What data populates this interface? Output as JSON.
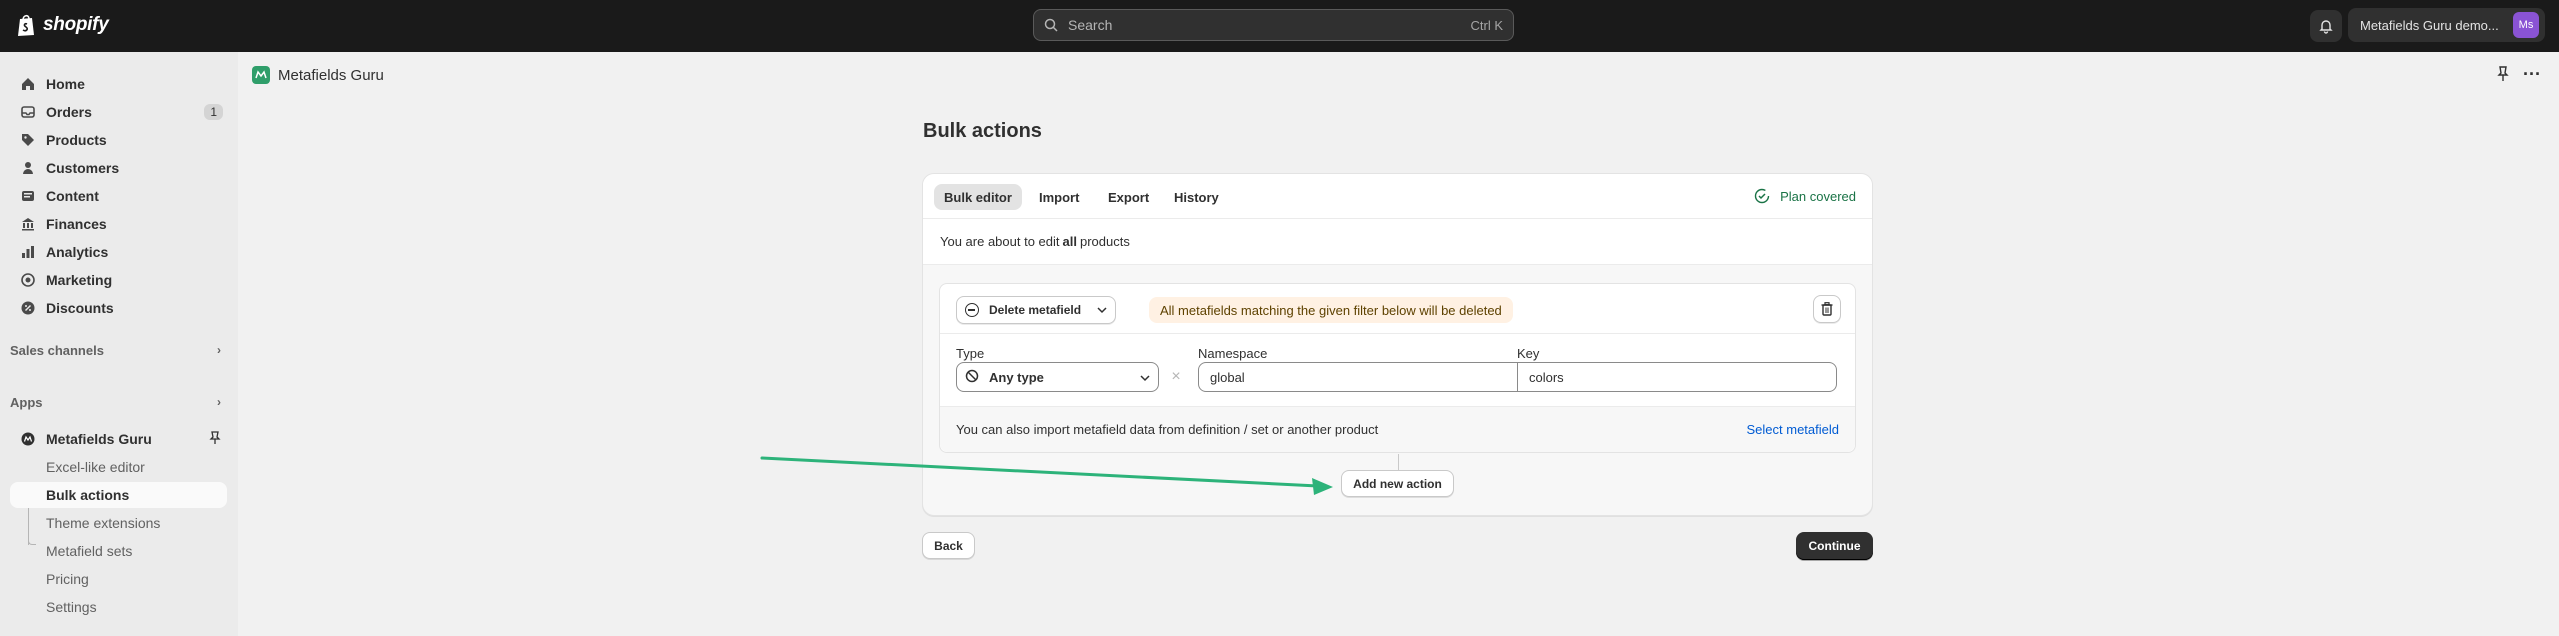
{
  "topbar": {
    "logo_text": "shopify",
    "search_placeholder": "Search",
    "search_shortcut": "Ctrl K",
    "store_name": "Metafields Guru demo...",
    "avatar_initials": "Ms",
    "avatar_color": "#8a53d4"
  },
  "sidebar": {
    "nav": [
      {
        "label": "Home",
        "icon": "home-icon"
      },
      {
        "label": "Orders",
        "icon": "inbox-icon",
        "badge": "1"
      },
      {
        "label": "Products",
        "icon": "tag-icon"
      },
      {
        "label": "Customers",
        "icon": "person-icon"
      },
      {
        "label": "Content",
        "icon": "content-icon"
      },
      {
        "label": "Finances",
        "icon": "bank-icon"
      },
      {
        "label": "Analytics",
        "icon": "chart-icon"
      },
      {
        "label": "Marketing",
        "icon": "target-icon"
      },
      {
        "label": "Discounts",
        "icon": "discount-icon"
      }
    ],
    "sales_channels": "Sales channels",
    "apps": "Apps",
    "app_name": "Metafields Guru",
    "app_subitems": [
      "Excel-like editor",
      "Bulk actions",
      "Theme extensions",
      "Metafield sets",
      "Pricing",
      "Settings"
    ]
  },
  "app_header": {
    "name": "Metafields Guru"
  },
  "page": {
    "title": "Bulk actions",
    "tabs": [
      "Bulk editor",
      "Import",
      "Export",
      "History"
    ],
    "plan_status": "Plan covered",
    "edit_prefix": "You are about to edit",
    "edit_bold": "all",
    "edit_suffix": "products",
    "action": {
      "select_label": "Delete metafield",
      "warning": "All metafields matching the given filter below will be deleted",
      "type_label": "Type",
      "type_value": "Any type",
      "namespace_label": "Namespace",
      "namespace_value": "global",
      "key_label": "Key",
      "key_value": "colors",
      "import_text": "You can also import metafield data from definition / set or another product",
      "select_metafield": "Select metafield"
    },
    "add_action": "Add new action",
    "back": "Back",
    "continue": "Continue"
  },
  "colors": {
    "topbar": "#1a1a1a",
    "accent_green": "#1a7346",
    "annotation_arrow": "#2db37a",
    "warning_bg": "#fff1e3",
    "link": "#005bd3"
  }
}
